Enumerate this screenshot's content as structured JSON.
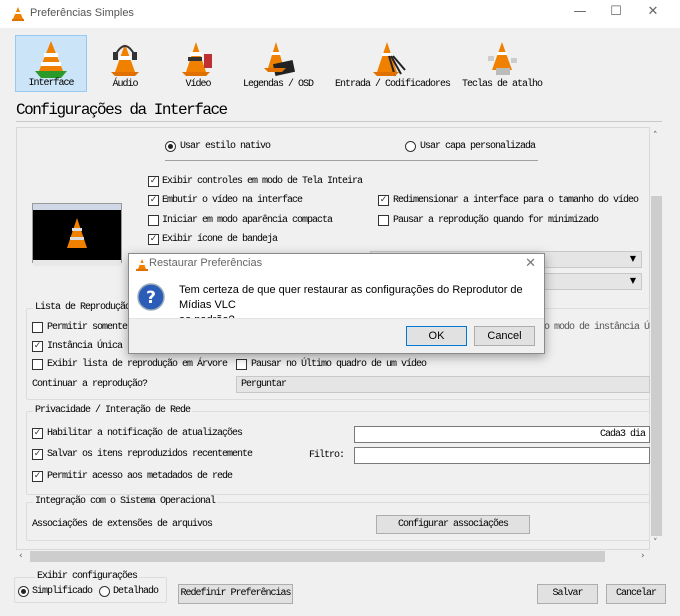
{
  "window": {
    "title": "Preferências Simples",
    "minimize": "—",
    "maximize": "☐",
    "close": "✕"
  },
  "toolbar": [
    {
      "label": "Interface",
      "selected": true
    },
    {
      "label": "Áudio"
    },
    {
      "label": "Vídeo"
    },
    {
      "label": "Legendas / OSD"
    },
    {
      "label": "Entrada / Codificadores"
    },
    {
      "label": "Teclas de atalho"
    }
  ],
  "heading": "Configurações da Interface",
  "look": {
    "native": "Usar estilo nativo",
    "skin": "Usar capa personalizada"
  },
  "options": {
    "fullscreen_controls": "Exibir controles em modo de Tela Inteira",
    "embed_video": "Embutir o vídeo na interface",
    "resize_interface": "Redimensionar a interface para o tamanho do vídeo",
    "compact_mode": "Iniciar em modo aparência compacta",
    "pause_minimized": "Pausar a reprodução quando for minimizado",
    "tray_icon": "Exibir ícone de bandeja"
  },
  "playlist": {
    "title": "Lista de Reprodução",
    "allow_one": "Permitir somente",
    "one_instance_tail": "o modo de instância Ún",
    "single_instance": "Instância Única",
    "tree": "Exibir lista de reprodução em Árvore",
    "pause_last": "Pausar no Último quadro de um vídeo",
    "continue_label": "Continuar a reprodução?",
    "continue_value": "Perguntar"
  },
  "privacy": {
    "title": "Privacidade / Interação de Rede",
    "updates": "Habilitar a notificação de atualizações",
    "updates_value": "Cada3 dia",
    "recent": "Salvar os itens reproduzidos recentemente",
    "filter_label": "Filtro:",
    "filter_value": "",
    "metadata": "Permitir acesso aos metadados de rede"
  },
  "os": {
    "title": "Integração com o Sistema Operacional",
    "assoc_label": "Associações de extensões de arquivos",
    "assoc_button": "Configurar associações"
  },
  "footer": {
    "show_title": "Exibir configurações",
    "simple": "Simplificado",
    "advanced": "Detalhado",
    "reset": "Redefinir Preferências",
    "save": "Salvar",
    "cancel": "Cancelar"
  },
  "dialog": {
    "title": "Restaurar Preferências",
    "message_line1": "Tem certeza de que quer restaurar as configurações do Reprodutor de Mídias VLC",
    "message_line2": "ao padrão?",
    "ok": "OK",
    "cancel": "Cancel"
  }
}
